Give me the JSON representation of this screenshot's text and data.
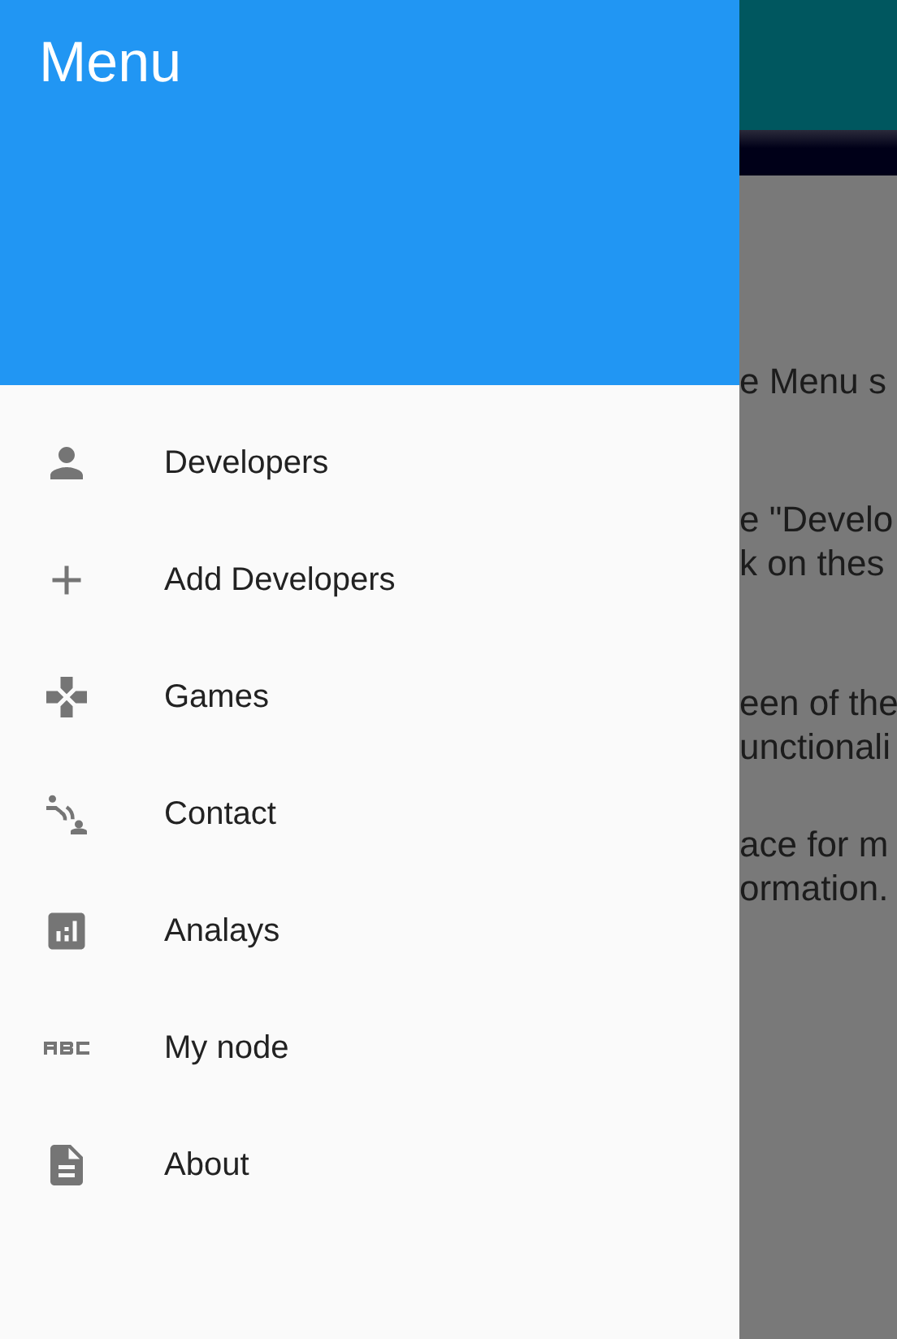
{
  "drawer": {
    "title": "Menu",
    "items": [
      {
        "kind": "person",
        "label": "Developers"
      },
      {
        "kind": "add",
        "label": "Add Developers"
      },
      {
        "kind": "gamepad",
        "label": "Games"
      },
      {
        "kind": "contact",
        "label": "Contact"
      },
      {
        "kind": "analytics",
        "label": "Analays"
      },
      {
        "kind": "abc",
        "label": "My node"
      },
      {
        "kind": "document",
        "label": "About"
      }
    ]
  },
  "background": {
    "paragraphs": [
      [
        "e Menu s"
      ],
      [
        "e \"Develo",
        "k on thes"
      ],
      [
        "een of the",
        "unctionali"
      ],
      [
        "ace for m",
        "ormation."
      ]
    ]
  }
}
